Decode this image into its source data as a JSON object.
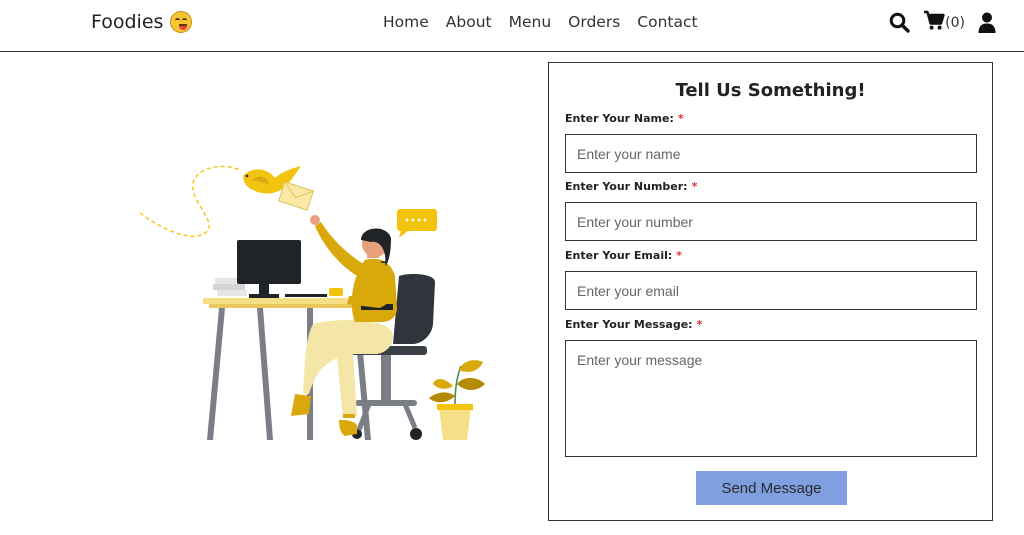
{
  "nav": {
    "brand": "Foodies",
    "brand_emoji": "face-savoring-food-icon",
    "links": [
      "Home",
      "About",
      "Menu",
      "Orders",
      "Contact"
    ],
    "cart_count": "(0)",
    "icons": [
      "search-icon",
      "cart-icon",
      "user-icon"
    ]
  },
  "form": {
    "title": "Tell Us Something!",
    "name_label": "Enter Your Name:",
    "name_placeholder": "Enter your name",
    "number_label": "Enter Your Number:",
    "number_placeholder": "Enter your number",
    "email_label": "Enter Your Email:",
    "email_placeholder": "Enter your email",
    "message_label": "Enter Your Message:",
    "message_placeholder": "Enter your message",
    "required_mark": "*",
    "submit_label": "Send Message"
  },
  "colors": {
    "accent_button": "#7f9fe0",
    "required": "#e0303a",
    "illustration_yellow": "#f2c40f"
  }
}
